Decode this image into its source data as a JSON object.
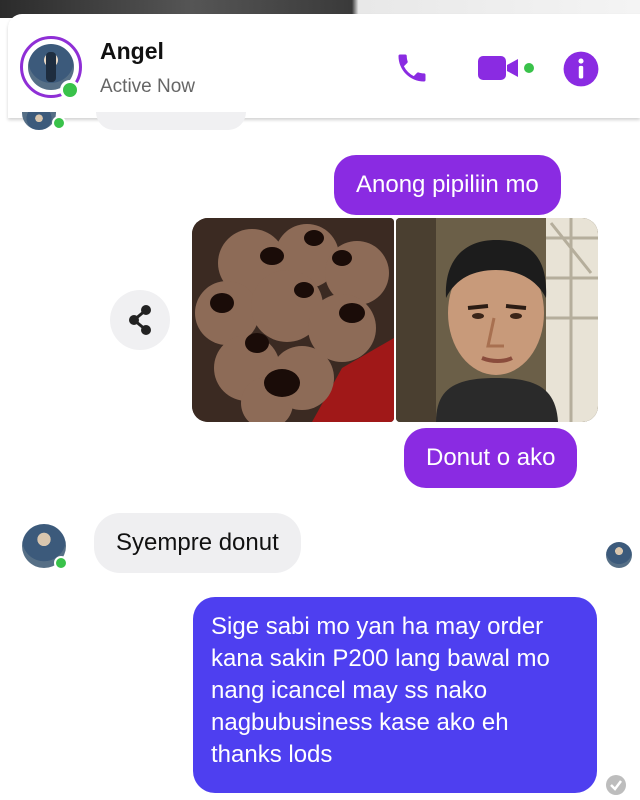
{
  "header": {
    "contact_name": "Angel",
    "status": "Active Now",
    "icons": [
      "phone-icon",
      "video-camera-icon",
      "info-icon"
    ],
    "accent_color": "#8a2be2",
    "online_color": "#39c24a"
  },
  "messages": [
    {
      "side": "right",
      "kind": "text",
      "text": "Anong pipiliin mo",
      "color": "#8a2be2"
    },
    {
      "side": "right",
      "kind": "images",
      "images": [
        "donut-photo",
        "selfie-photo"
      ]
    },
    {
      "side": "right",
      "kind": "text",
      "text": "Donut o ako",
      "color": "#8a2be2"
    },
    {
      "side": "left",
      "kind": "text",
      "text": "Syempre donut",
      "color": "#efeff1"
    },
    {
      "side": "right",
      "kind": "text",
      "text": "Sige sabi mo yan ha may order kana sakin P200 lang bawal mo nang icancel may ss nako nagbubusiness kase ako eh thanks lods",
      "color": "#4e3ff0"
    }
  ]
}
